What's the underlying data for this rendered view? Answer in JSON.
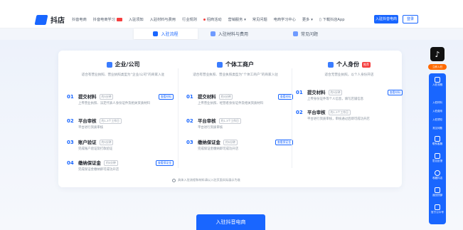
{
  "header": {
    "logo_text": "抖店",
    "nav": [
      "抖音电商",
      "抖音电商学习",
      "入驻须知",
      "入驻材料与费用",
      "行业规则",
      "招商活动",
      "营销服务",
      "常见问题",
      "电商学习中心",
      "更多"
    ],
    "app_link": "下载抖店App",
    "settle_button": "入驻抖音电商",
    "login_button": "登录"
  },
  "tabs": [
    "入驻流程",
    "入驻材料与费用",
    "常见问题"
  ],
  "columns": [
    {
      "title": "企业/公司",
      "badge": "",
      "desc": "适合有营业执照、营业执照类型为“企业/公司”的商家入驻",
      "steps": [
        {
          "num": "01",
          "name": "提交材料",
          "tag": "约5分钟",
          "link": "查看材料",
          "text": "上传营业执照、法定代表人身份证件及相关资质材料"
        },
        {
          "num": "02",
          "name": "平台审核",
          "tag": "约1-3个工作日",
          "link": "",
          "text": "平台进行资质审核"
        },
        {
          "num": "03",
          "name": "账户验证",
          "tag": "约5分钟",
          "link": "",
          "text": "完成账户验证及打款验证"
        },
        {
          "num": "04",
          "name": "缴纳保证金",
          "tag": "约5分钟",
          "link": "查看保证金",
          "text": "完成保证金缴纳即可成功开店"
        }
      ]
    },
    {
      "title": "个体工商户",
      "badge": "",
      "desc": "适合有营业执照、营业执照类型为“个体工商户”的商家入驻",
      "steps": [
        {
          "num": "01",
          "name": "提交材料",
          "tag": "约5分钟",
          "link": "查看材料",
          "text": "上传营业执照、经营者身份证件及相关资质材料"
        },
        {
          "num": "02",
          "name": "平台审核",
          "tag": "约1-3个工作日",
          "link": "",
          "text": "平台进行资质审核"
        },
        {
          "num": "03",
          "name": "缴纳保证金",
          "tag": "约5分钟",
          "link": "查看保证金",
          "text": "完成保证金缴纳即可成功开店"
        }
      ]
    },
    {
      "title": "个人身份",
      "badge": "推荐",
      "desc": "适合无营业执照，以个人身份开店",
      "steps": [
        {
          "num": "01",
          "name": "提交材料",
          "tag": "约5分钟",
          "link": "查看材料",
          "text": "上传身份证件等个人信息，填写店铺信息"
        },
        {
          "num": "02",
          "name": "平台审核",
          "tag": "约1-3个工作日",
          "link": "",
          "text": "平台进行资质审核，审核通过后即可成功开店"
        }
      ]
    }
  ],
  "footnote": "具体入驻流程和材料请以入驻页面实际展示为准",
  "cta": "入驻抖音电商",
  "sidebar": {
    "pill": "立即入驻",
    "panel_title": "入驻流程",
    "sub_items": [
      "入驻材料",
      "入驻费用",
      "入驻须知",
      "常见问题"
    ],
    "items": [
      "联系客服",
      "意见反馈",
      "收藏抖店",
      "返回顶部",
      "官方公众号"
    ]
  },
  "colors": {
    "brand": "#1966ff",
    "hot": "#f53f3f",
    "pill": "#ff6a00"
  }
}
